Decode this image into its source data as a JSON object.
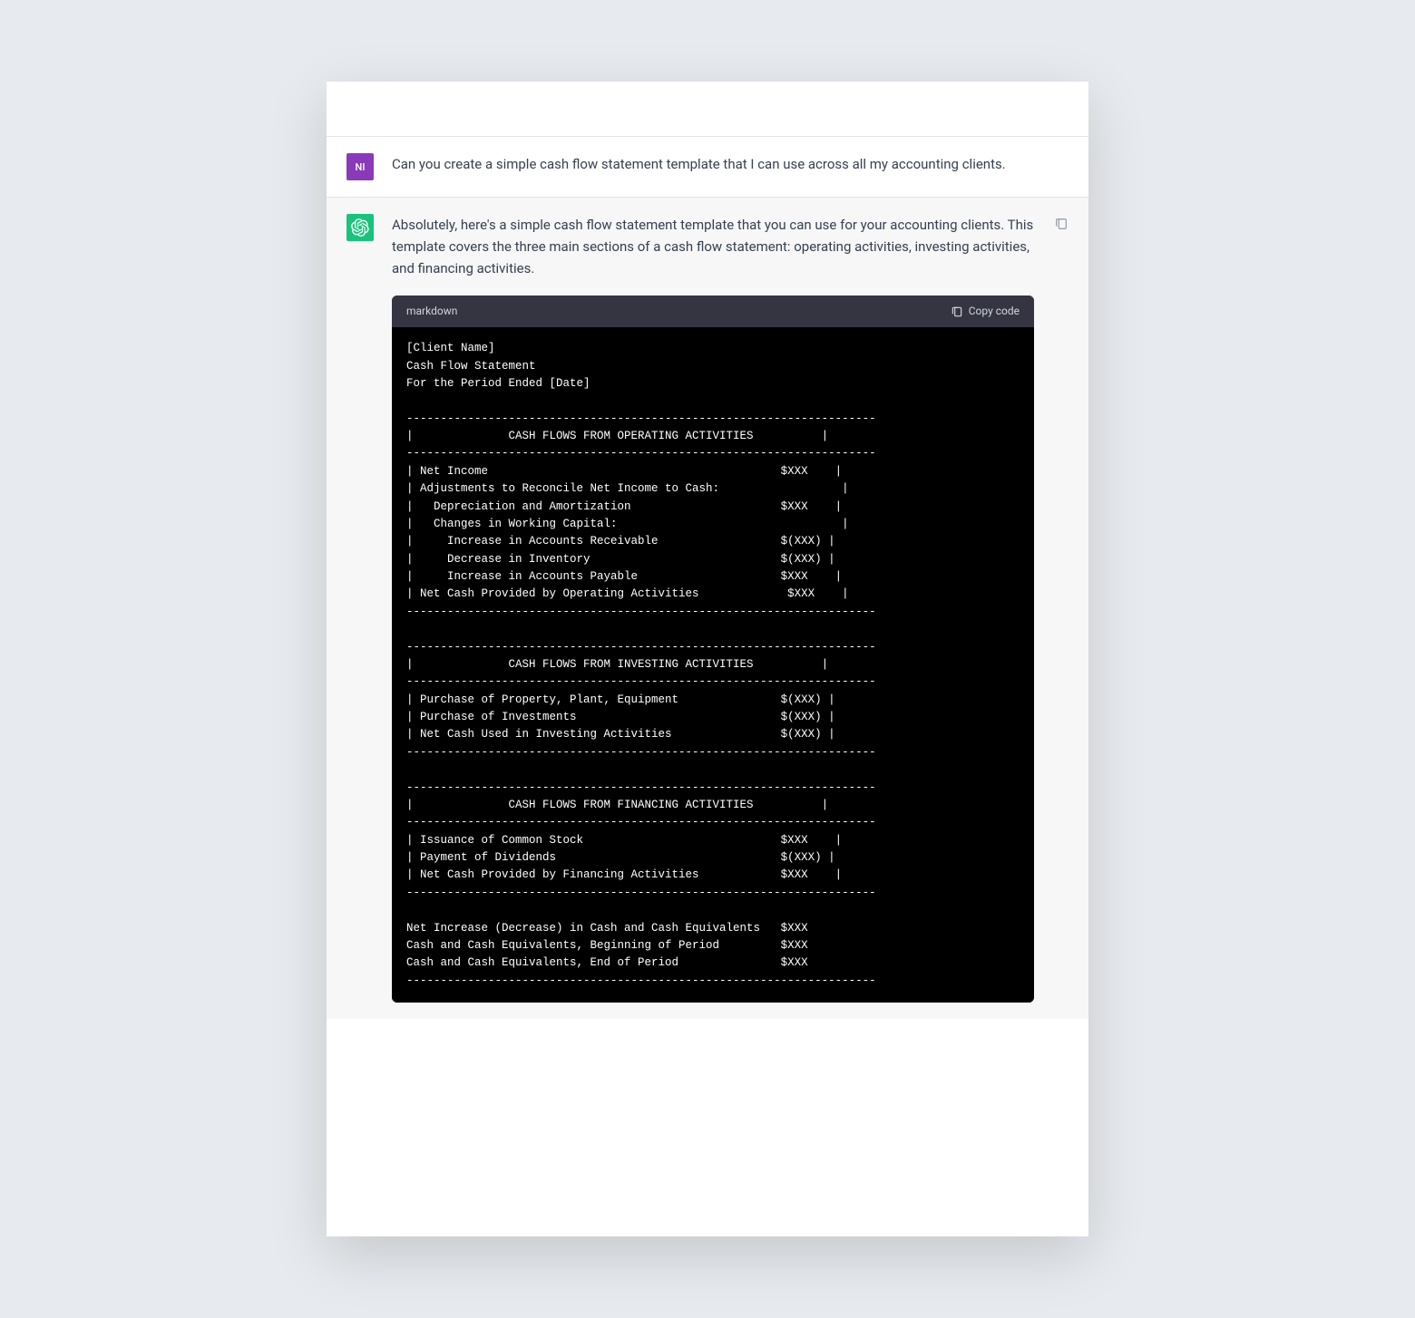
{
  "user": {
    "avatar_initials": "NI",
    "message": "Can you create a simple cash flow statement template that I can use across all my accounting clients."
  },
  "assistant": {
    "intro": "Absolutely, here's a simple cash flow statement template that you can use for your accounting clients. This template covers the three main sections of a cash flow statement: operating activities, investing activities, and financing activities.",
    "code_lang": "markdown",
    "copy_label": "Copy code",
    "code": "[Client Name]\nCash Flow Statement\nFor the Period Ended [Date]\n\n---------------------------------------------------------------------\n|              CASH FLOWS FROM OPERATING ACTIVITIES          |\n---------------------------------------------------------------------\n| Net Income                                           $XXX    |\n| Adjustments to Reconcile Net Income to Cash:                  |\n|   Depreciation and Amortization                      $XXX    |\n|   Changes in Working Capital:                                 |\n|     Increase in Accounts Receivable                  $(XXX) |\n|     Decrease in Inventory                            $(XXX) |\n|     Increase in Accounts Payable                     $XXX    |\n| Net Cash Provided by Operating Activities             $XXX    |\n---------------------------------------------------------------------\n\n---------------------------------------------------------------------\n|              CASH FLOWS FROM INVESTING ACTIVITIES          |\n---------------------------------------------------------------------\n| Purchase of Property, Plant, Equipment               $(XXX) |\n| Purchase of Investments                              $(XXX) |\n| Net Cash Used in Investing Activities                $(XXX) |\n---------------------------------------------------------------------\n\n---------------------------------------------------------------------\n|              CASH FLOWS FROM FINANCING ACTIVITIES          |\n---------------------------------------------------------------------\n| Issuance of Common Stock                             $XXX    |\n| Payment of Dividends                                 $(XXX) |\n| Net Cash Provided by Financing Activities            $XXX    |\n---------------------------------------------------------------------\n\nNet Increase (Decrease) in Cash and Cash Equivalents   $XXX\nCash and Cash Equivalents, Beginning of Period         $XXX\nCash and Cash Equivalents, End of Period               $XXX\n---------------------------------------------------------------------"
  }
}
